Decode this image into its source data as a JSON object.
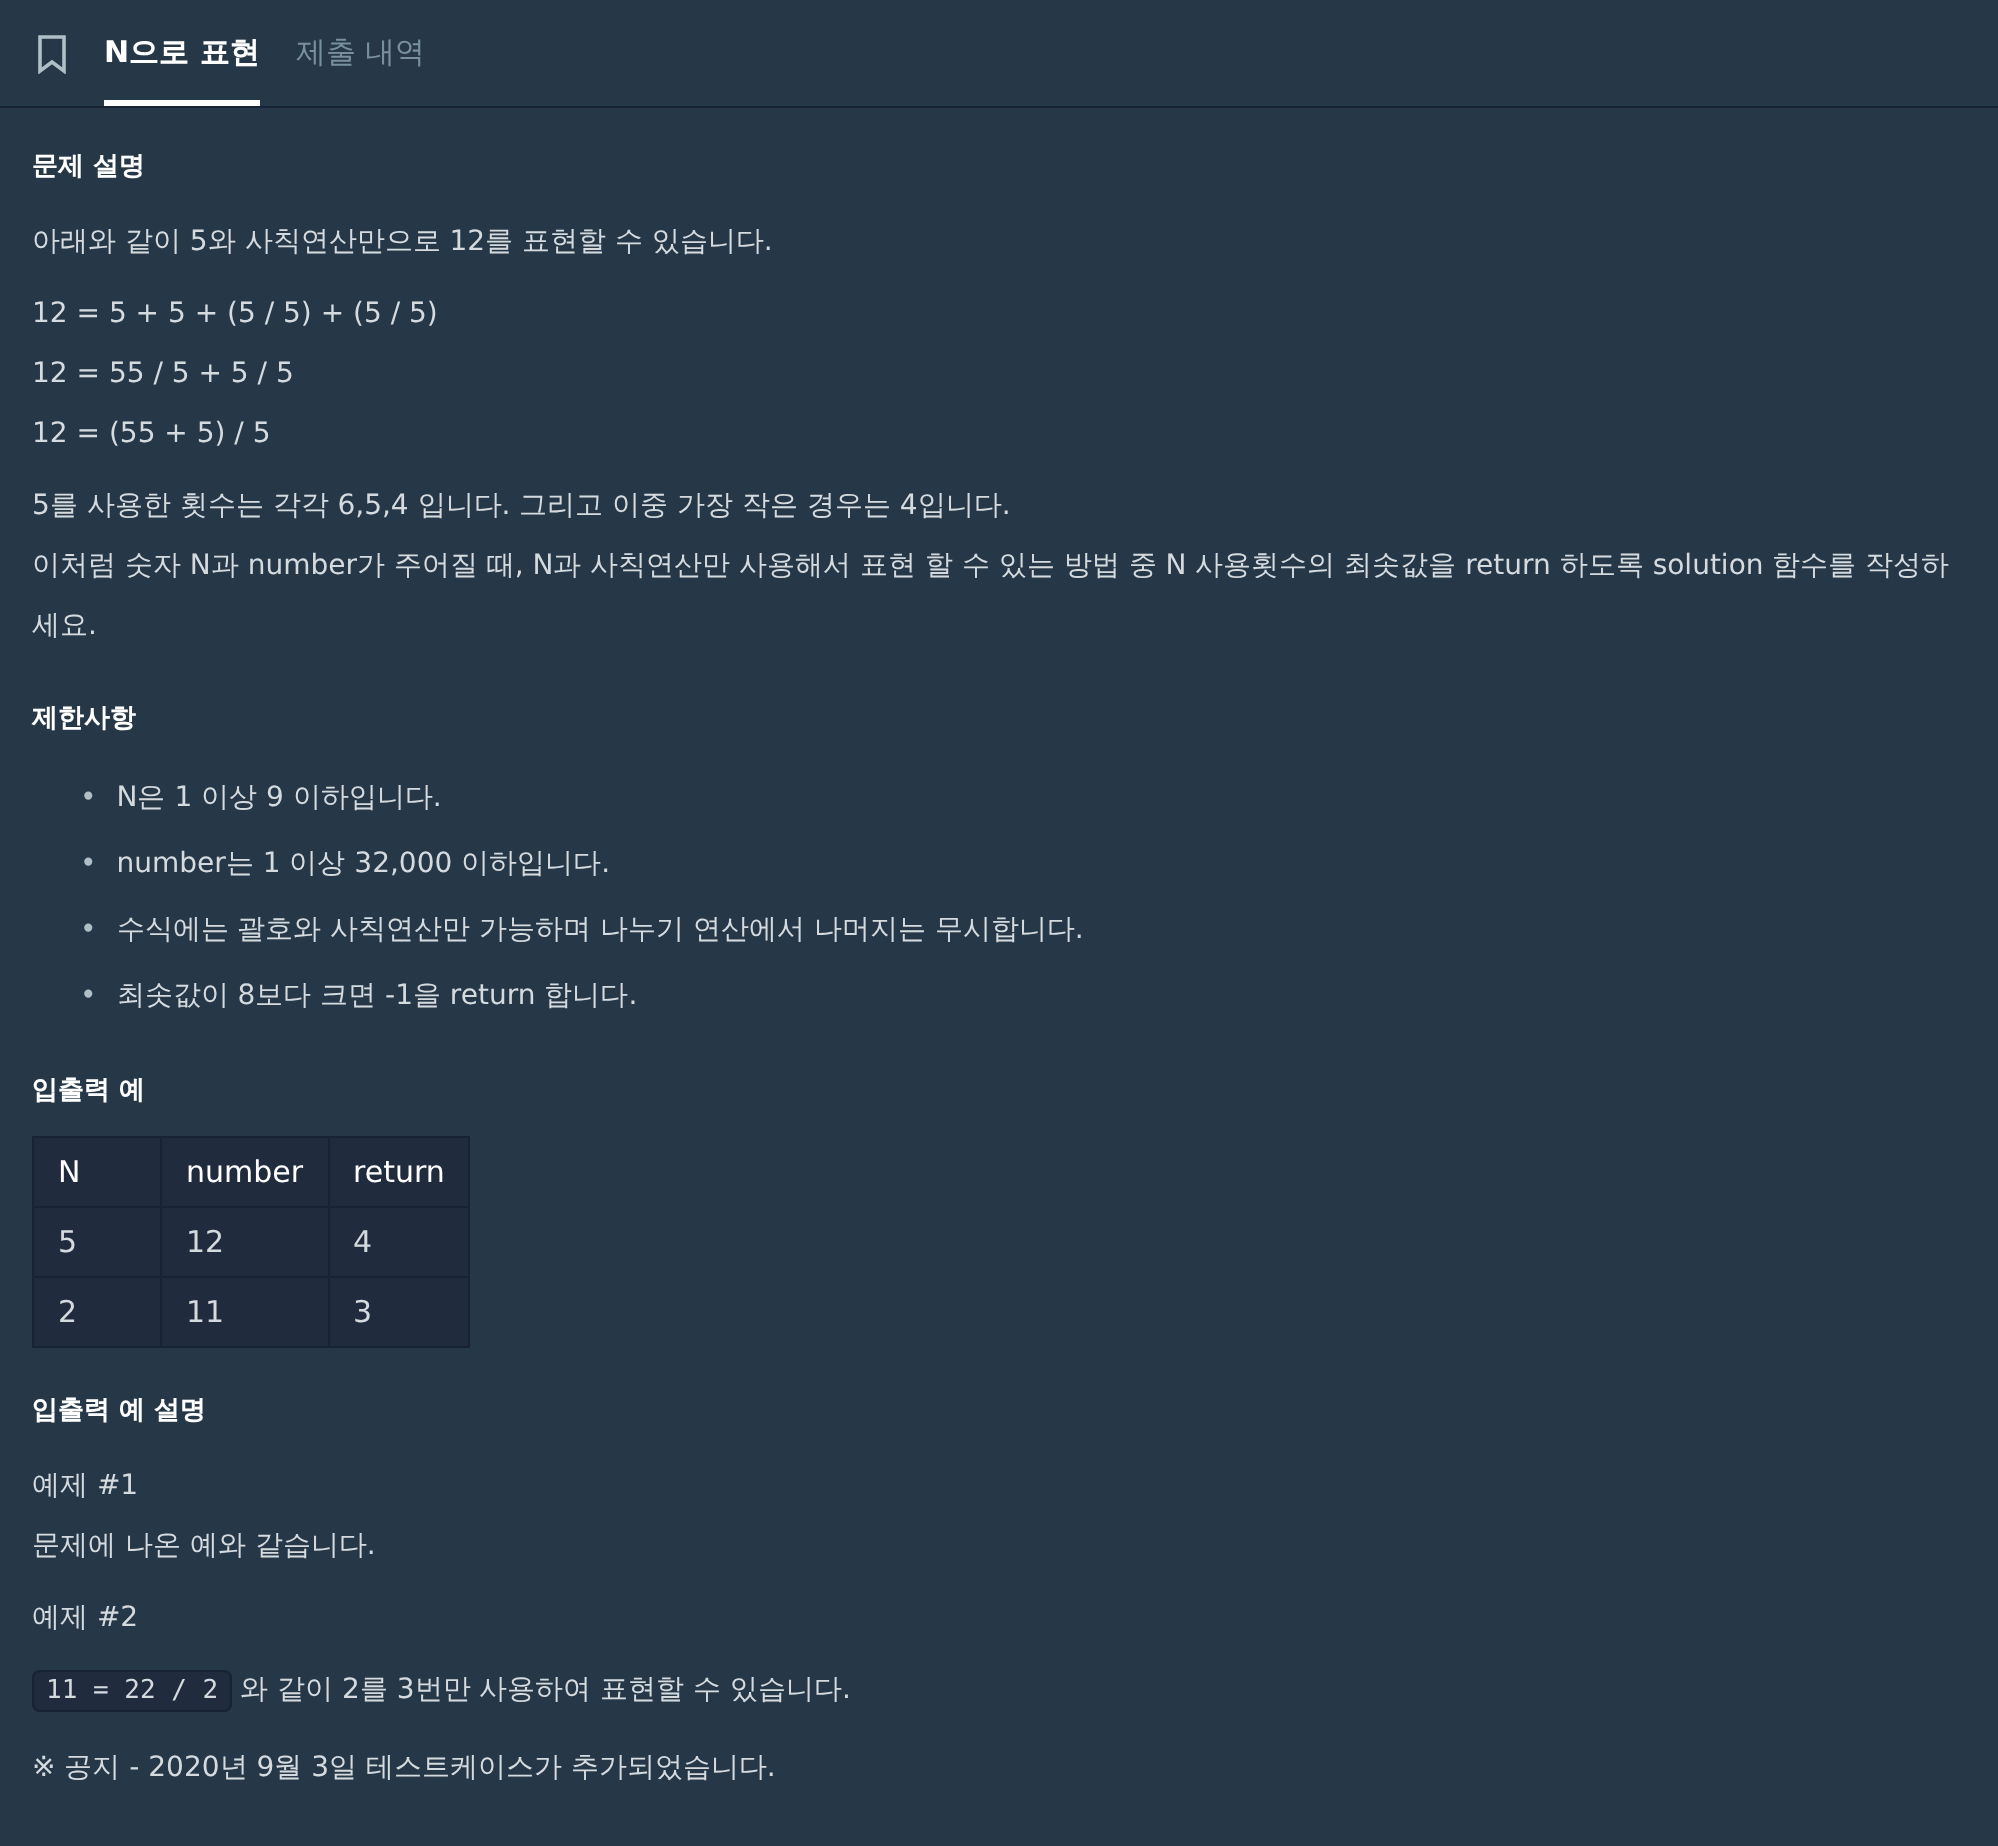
{
  "tabs": [
    {
      "label": "N으로 표현",
      "selected": true
    },
    {
      "label": "제출 내역",
      "selected": false
    }
  ],
  "sections": [
    {
      "heading": "문제 설명",
      "blocks": [
        {
          "kind": "para",
          "lines": [
            "아래와 같이 5와 사칙연산만으로 12를 표현할 수 있습니다."
          ]
        },
        {
          "kind": "para",
          "lines": [
            "12 = 5 + 5 + (5 / 5) + (5 / 5)",
            "12 = 55 / 5 + 5 / 5",
            "12 = (55 + 5) / 5"
          ]
        },
        {
          "kind": "para",
          "lines": [
            "5를 사용한 횟수는 각각 6,5,4 입니다. 그리고 이중 가장 작은 경우는 4입니다.",
            "이처럼 숫자 N과 number가 주어질 때, N과 사칙연산만 사용해서 표현 할 수 있는 방법 중 N 사용횟수의 최솟값을 return 하도록 solution 함수를 작성하세요."
          ]
        }
      ]
    },
    {
      "heading": "제한사항",
      "blocks": [
        {
          "kind": "bullets",
          "marker": "•",
          "items": [
            "N은 1 이상 9 이하입니다.",
            "number는 1 이상 32,000 이하입니다.",
            "수식에는 괄호와 사칙연산만 가능하며 나누기 연산에서 나머지는 무시합니다.",
            "최솟값이 8보다 크면 -1을 return 합니다."
          ]
        }
      ]
    },
    {
      "heading": "입출력 예",
      "blocks": [
        {
          "kind": "table",
          "columns": [
            "N",
            "number",
            "return"
          ],
          "rows": [
            [
              "5",
              "12",
              "4"
            ],
            [
              "2",
              "11",
              "3"
            ]
          ]
        }
      ]
    },
    {
      "heading": "입출력 예 설명",
      "blocks": [
        {
          "kind": "para",
          "lines": [
            "예제 #1",
            "문제에 나온 예와 같습니다."
          ]
        },
        {
          "kind": "para",
          "lines": [
            "예제 #2"
          ]
        },
        {
          "kind": "code_line",
          "code": "11 = 22 / 2",
          "text": "와 같이 2를 3번만 사용하여 표현할 수 있습니다."
        },
        {
          "kind": "para",
          "lines": [
            "※ 공지 - 2020년 9월 3일 테스트케이스가 추가되었습니다."
          ]
        }
      ]
    }
  ]
}
